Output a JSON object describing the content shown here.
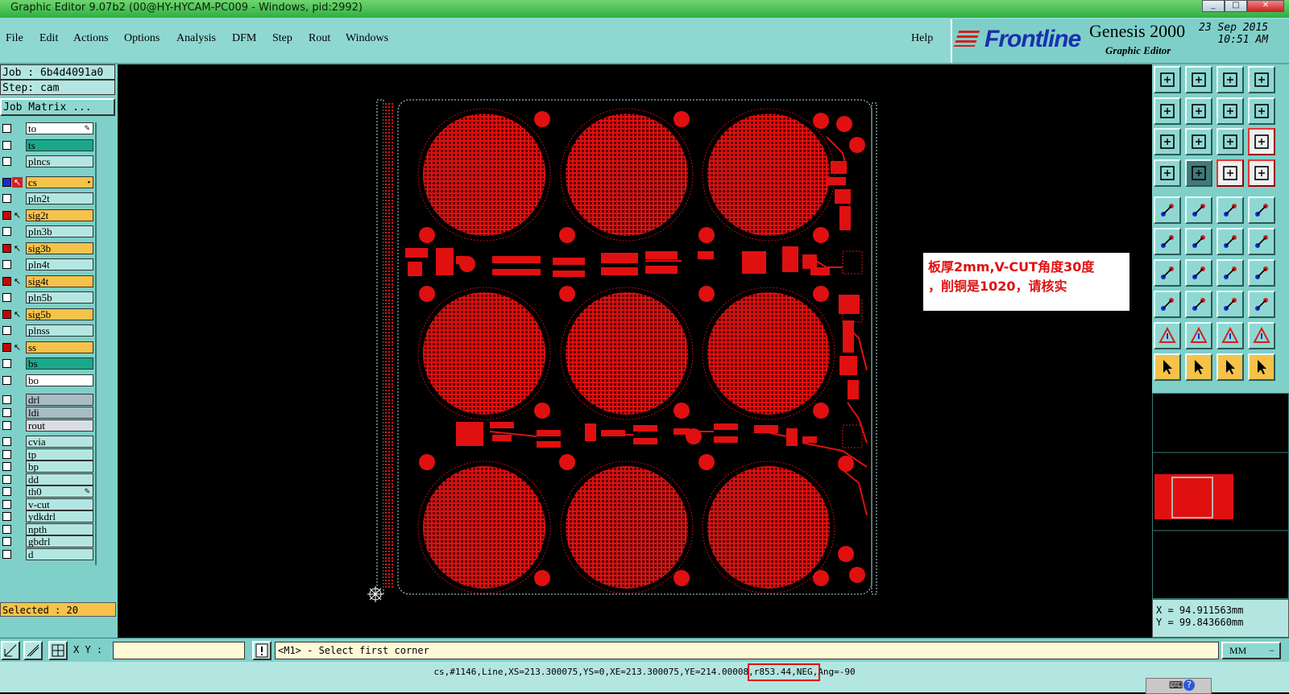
{
  "window": {
    "title": "Graphic Editor 9.07b2 (00@HY-HYCAM-PC009 - Windows, pid:2992)",
    "controls": [
      "_",
      "□",
      "✕"
    ]
  },
  "menu": {
    "items": [
      "File",
      "Edit",
      "Actions",
      "Options",
      "Analysis",
      "DFM",
      "Step",
      "Rout",
      "Windows"
    ],
    "help": "Help"
  },
  "brand": {
    "logo": "Frontline",
    "product": "Genesis 2000",
    "subtitle": "Graphic Editor",
    "date": "23 Sep 2015",
    "time": "10:51 AM"
  },
  "job": {
    "job_label": "Job : 6b4d4091a0",
    "step_label": "Step: cam",
    "matrix_button": "Job Matrix ..."
  },
  "layers": [
    {
      "name": "to",
      "color": "#ffffff",
      "checked": false,
      "pointer": false,
      "mark": "tool"
    },
    {
      "name": "ts",
      "color": "#1aa88a",
      "checked": false,
      "pointer": false
    },
    {
      "name": "plncs",
      "color": "#b4e6e1",
      "checked": false,
      "pointer": false
    },
    {
      "name": "cs",
      "color": "#f5c24a",
      "checked": true,
      "blue": true,
      "pointer": true,
      "red_pointer": true,
      "mark": "box"
    },
    {
      "name": "pln2t",
      "color": "#b4e6e1",
      "checked": false,
      "pointer": false
    },
    {
      "name": "sig2t",
      "color": "#f5c24a",
      "checked": true,
      "pointer": true
    },
    {
      "name": "pln3b",
      "color": "#b4e6e1",
      "checked": false,
      "pointer": false
    },
    {
      "name": "sig3b",
      "color": "#f5c24a",
      "checked": true,
      "pointer": true
    },
    {
      "name": "pln4t",
      "color": "#b4e6e1",
      "checked": false,
      "pointer": false
    },
    {
      "name": "sig4t",
      "color": "#f5c24a",
      "checked": true,
      "pointer": true
    },
    {
      "name": "pln5b",
      "color": "#b4e6e1",
      "checked": false,
      "pointer": false
    },
    {
      "name": "sig5b",
      "color": "#f5c24a",
      "checked": true,
      "pointer": true
    },
    {
      "name": "plnss",
      "color": "#b4e6e1",
      "checked": false,
      "pointer": false
    },
    {
      "name": "ss",
      "color": "#f5c24a",
      "checked": true,
      "pointer": true
    },
    {
      "name": "bs",
      "color": "#1aa88a",
      "checked": false,
      "pointer": false
    },
    {
      "name": "bo",
      "color": "#ffffff",
      "checked": false,
      "pointer": false
    },
    {
      "name": "drl",
      "color": "#a9bcc6",
      "checked": false,
      "pointer": false
    },
    {
      "name": "ldi",
      "color": "#a9bcc6",
      "checked": false,
      "pointer": false
    },
    {
      "name": "rout",
      "color": "#d6dfe3",
      "checked": false,
      "pointer": false
    },
    {
      "name": "cvia",
      "color": "#b4e6e1",
      "checked": false,
      "pointer": false
    },
    {
      "name": "tp",
      "color": "#b4e6e1",
      "checked": false,
      "pointer": false
    },
    {
      "name": "bp",
      "color": "#b4e6e1",
      "checked": false,
      "pointer": false
    },
    {
      "name": "dd",
      "color": "#b4e6e1",
      "checked": false,
      "pointer": false
    },
    {
      "name": "th0",
      "color": "#b4e6e1",
      "checked": false,
      "pointer": false,
      "mark": "tool"
    },
    {
      "name": "v-cut",
      "color": "#b4e6e1",
      "checked": false,
      "pointer": false
    },
    {
      "name": "ydkdrl",
      "color": "#b4e6e1",
      "checked": false,
      "pointer": false
    },
    {
      "name": "npth",
      "color": "#b4e6e1",
      "checked": false,
      "pointer": false
    },
    {
      "name": "gbdrl",
      "color": "#b4e6e1",
      "checked": false,
      "pointer": false
    },
    {
      "name": "d",
      "color": "#b4e6e1",
      "checked": false,
      "pointer": false
    }
  ],
  "selected_label": "Selected : 20",
  "note": {
    "line1": "板厚2mm,V-CUT角度30度",
    "line2": "，削铜是1020，请核实"
  },
  "coords": {
    "x": "X = 94.911563mm",
    "y": "Y = 99.843660mm"
  },
  "command": {
    "xy_label": "X Y :",
    "xy_value": "",
    "prompt": "<M1> - Select first corner",
    "unit": "MM"
  },
  "status": {
    "feature": "cs,#1146,Line,XS=213.300075,YS=0,XE=213.300075,YE=214.00008,r853.44,NEG,Ang=-90"
  },
  "colors": {
    "copper": "#e01010",
    "panel": "#7fd0c8",
    "highlight": "#f5c24a"
  }
}
